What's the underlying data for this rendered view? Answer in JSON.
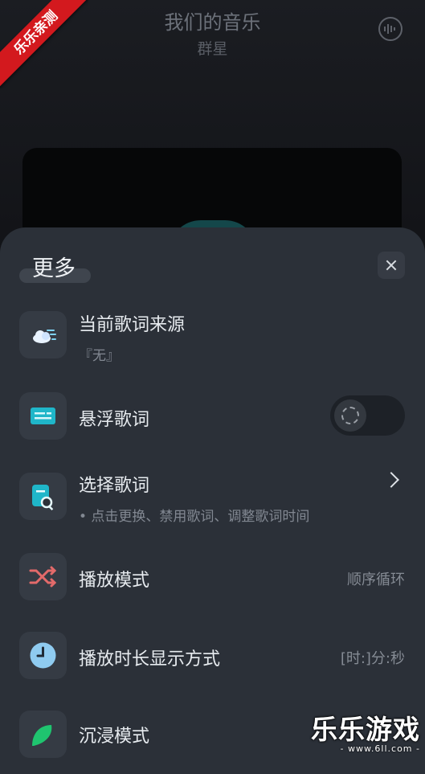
{
  "player": {
    "song_title": "我们的音乐",
    "artist": "群星"
  },
  "badge": "乐乐亲测",
  "sheet": {
    "title": "更多",
    "items": [
      {
        "label": "当前歌词来源",
        "sub": "『无』",
        "icon": "cloud-icon"
      },
      {
        "label": "悬浮歌词",
        "icon": "floating-lyrics-icon",
        "toggle_on": false
      },
      {
        "label": "选择歌词",
        "sub": "• 点击更换、禁用歌词、调整歌词时间",
        "icon": "lyrics-search-icon"
      },
      {
        "label": "播放模式",
        "value": "顺序循环",
        "icon": "shuffle-icon"
      },
      {
        "label": "播放时长显示方式",
        "value": "[时:]分:秒",
        "icon": "clock-icon"
      },
      {
        "label": "沉浸模式",
        "icon": "immersive-icon"
      }
    ]
  },
  "watermark": {
    "main": "乐乐游戏",
    "url": "- www.6ll.com -"
  },
  "colors": {
    "sheet_bg": "#2b3038",
    "accent_teal": "#1fb6c9",
    "shuffle_red": "#e36a6a",
    "clock_blue": "#8fcbf0",
    "immersive_green": "#1fc46f",
    "badge_red": "#d3191e"
  }
}
